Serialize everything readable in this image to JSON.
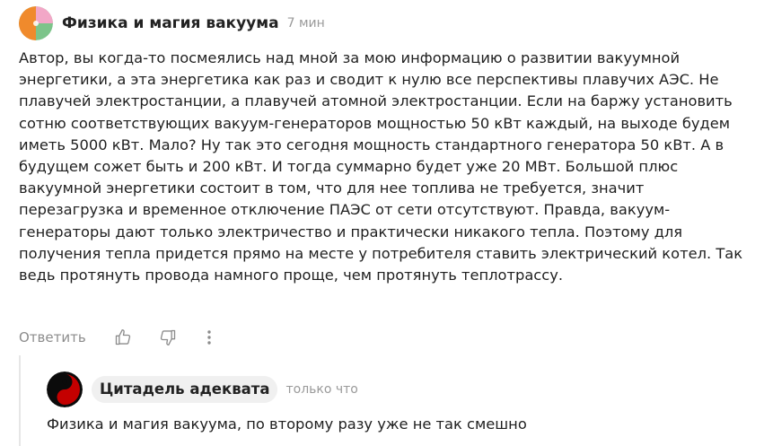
{
  "comment": {
    "author": "Физика и магия вакуума",
    "time": "7 мин",
    "text": "Автор, вы когда-то посмеялись над мной за мою информацию о развитии вакуумной энергетики, а эта энергетика как раз и сводит к нулю все перспективы плавучих АЭС. Не плавучей электростанции, а плавучей атомной электростанции. Если на баржу установить сотню соответствующих вакуум-генераторов мощностью 50 кВт каждый, на выходе будем иметь 5000 кВт. Мало? Ну так это сегодня мощность стандартного генератора 50 кВт. А в будущем сожет быть и 200 кВт. И тогда суммарно будет уже 20 МВт. Большой плюс вакуумной энергетики состоит в том, что для нее топлива не требуется, значит перезагрузка и временное отключение ПАЭС от сети отсутствуют. Правда, вакуум-генераторы дают только электричество и практически никакого тепла. Поэтому для получения тепла придется прямо на месте у потребителя ставить электрический котел. Так ведь протянуть провода намного проще, чем протянуть теплотрассу.",
    "actions": {
      "reply_label": "Ответить"
    }
  },
  "reply": {
    "author": "Цитадель адеквата",
    "time": "только что",
    "text": "Физика и магия вакуума, по второму разу уже не так смешно"
  },
  "icons": {
    "main_avatar": "tricolor-circle-avatar",
    "reply_avatar": "yin-yang-avatar",
    "like": "thumbs-up-icon",
    "dislike": "thumbs-down-icon",
    "more": "vertical-dots-icon"
  },
  "colors": {
    "text": "#1f1f1f",
    "muted": "#8c8c8c",
    "chip_bg": "#f0f0f0",
    "avatar_orange": "#f08a2c",
    "avatar_green": "#7cc48a",
    "avatar_pink": "#f2a7c7",
    "reply_avatar_red": "#c40000"
  }
}
